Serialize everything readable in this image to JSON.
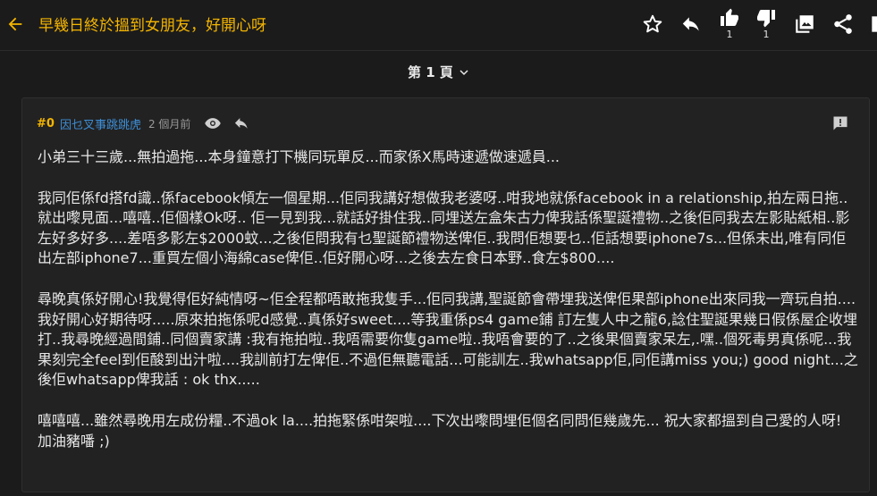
{
  "header": {
    "title": "早幾日終於搵到女朋友，好開心呀",
    "like_count": "1",
    "dislike_count": "1"
  },
  "pagination": {
    "label": "第 1 頁"
  },
  "post": {
    "floor": "#0",
    "author": "因乜叉事跳跳虎",
    "time": "2 個月前",
    "paragraphs": [
      "小弟三十三歲...無拍過拖...本身鐘意打下機同玩單反...而家係X馬時速遞做速遞員...",
      "我同佢係fd搭fd識..係facebook傾左一個星期...佢同我講好想做我老婆呀..咁我地就係facebook in a relationship,拍左兩日拖..就出嚟見面...嘻嘻..佢個樣Ok呀.. 佢一見到我...就話好掛住我..同埋送左盒朱古力俾我話係聖誕禮物..之後佢同我去左影貼紙相..影左好多好多....差唔多影左$2000蚊...之後佢問我有乜聖誕節禮物送俾佢..我問佢想要乜..佢話想要iphone7s...但係未出,唯有同佢出左部iphone7...重買左個小海綿case俾佢..佢好開心呀...之後去左食日本野..食左$800....",
      "尋晚真係好開心!我覺得佢好純情呀~佢全程都唔敢拖我隻手...佢同我講,聖誕節會帶埋我送俾佢果部iphone出來同我一齊玩自拍....我好開心好期待呀.....原來拍拖係呢d感覺..真係好sweet....等我重係ps4 game鋪 訂左隻人中之龍6,諗住聖誕果幾日假係屋企收埋打..我尋晚經過間鋪..同個賣家講 :我有拖拍啦..我唔需要你隻game啦..我唔會要的了..之後果個賣家呆左,.嘿..個死毒男真係呢...我果刻完全feel到佢酸到出汁啦....我訓前打左俾佢..不過佢無聽電話...可能訓左..我whatsapp佢,同佢講miss you;) good night...之後佢whatsapp俾我話 : ok thx.....",
      "嘻嘻嘻...雖然尋晚用左成份糧..不過ok la....拍拖緊係咁架啦....下次出嚟問埋佢個名同問佢幾歲先... 祝大家都搵到自己愛的人呀! 加油豬噃 ;)"
    ]
  },
  "colors": {
    "accent": "#f4b500",
    "author_link": "#3d8fd8",
    "background": "#1b1b1b",
    "card": "#222222"
  },
  "icons": [
    "back-arrow-icon",
    "star-icon",
    "reply-icon",
    "thumbs-up-icon",
    "thumbs-down-icon",
    "image-icon",
    "share-icon",
    "chevron-down-icon",
    "eye-icon",
    "report-icon"
  ]
}
